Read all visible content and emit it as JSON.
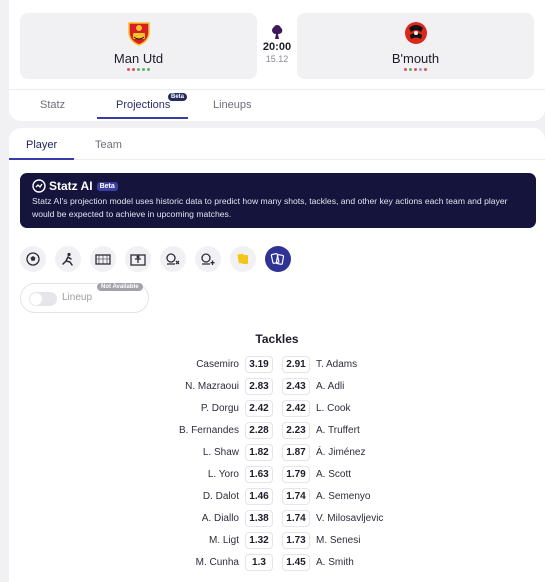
{
  "match": {
    "home": {
      "name": "Man Utd",
      "form_colors": [
        "#e0505c",
        "#e0505c",
        "#56b36b",
        "#56b36b",
        "#56b36b"
      ]
    },
    "away": {
      "name": "B'mouth",
      "form_colors": [
        "#e0505c",
        "#56b36b",
        "#e0505c",
        "#9aa0b5",
        "#e0505c"
      ]
    },
    "time": "20:00",
    "date": "15.12"
  },
  "tabs": [
    {
      "label": "Statz"
    },
    {
      "label": "Projections",
      "badge": "Beta"
    },
    {
      "label": "Lineups"
    }
  ],
  "subtabs": [
    {
      "label": "Player"
    },
    {
      "label": "Team"
    }
  ],
  "ai_banner": {
    "title": "Statz AI",
    "badge": "Beta",
    "description": "Statz AI's projection model uses historic data to predict how many shots, tackles, and other key actions each team and player would be expected to achieve in upcoming matches."
  },
  "stat_icons": [
    "football-icon",
    "tackle-icon",
    "goal-icon",
    "goalkeeper-icon",
    "missed-shot-icon",
    "shot-plus-icon",
    "yellow-cards-icon",
    "cards-icon"
  ],
  "lineup_toggle": {
    "label": "Lineup",
    "badge": "Not Available",
    "enabled": false
  },
  "stat_title": "Tackles",
  "rows": [
    {
      "home": "Casemiro",
      "home_val": "3.19",
      "away_val": "2.91",
      "away": "T. Adams"
    },
    {
      "home": "N. Mazraoui",
      "home_val": "2.83",
      "away_val": "2.43",
      "away": "A. Adli"
    },
    {
      "home": "P. Dorgu",
      "home_val": "2.42",
      "away_val": "2.42",
      "away": "L. Cook"
    },
    {
      "home": "B. Fernandes",
      "home_val": "2.28",
      "away_val": "2.23",
      "away": "A. Truffert"
    },
    {
      "home": "L. Shaw",
      "home_val": "1.82",
      "away_val": "1.87",
      "away": "Á. Jiménez"
    },
    {
      "home": "L. Yoro",
      "home_val": "1.63",
      "away_val": "1.79",
      "away": "A. Scott"
    },
    {
      "home": "D. Dalot",
      "home_val": "1.46",
      "away_val": "1.74",
      "away": "A. Semenyo"
    },
    {
      "home": "A. Diallo",
      "home_val": "1.38",
      "away_val": "1.74",
      "away": "V. Milosavljevic"
    },
    {
      "home": "M. Ligt",
      "home_val": "1.32",
      "away_val": "1.73",
      "away": "M. Senesi"
    },
    {
      "home": "M. Cunha",
      "home_val": "1.3",
      "away_val": "1.45",
      "away": "A. Smith"
    }
  ]
}
